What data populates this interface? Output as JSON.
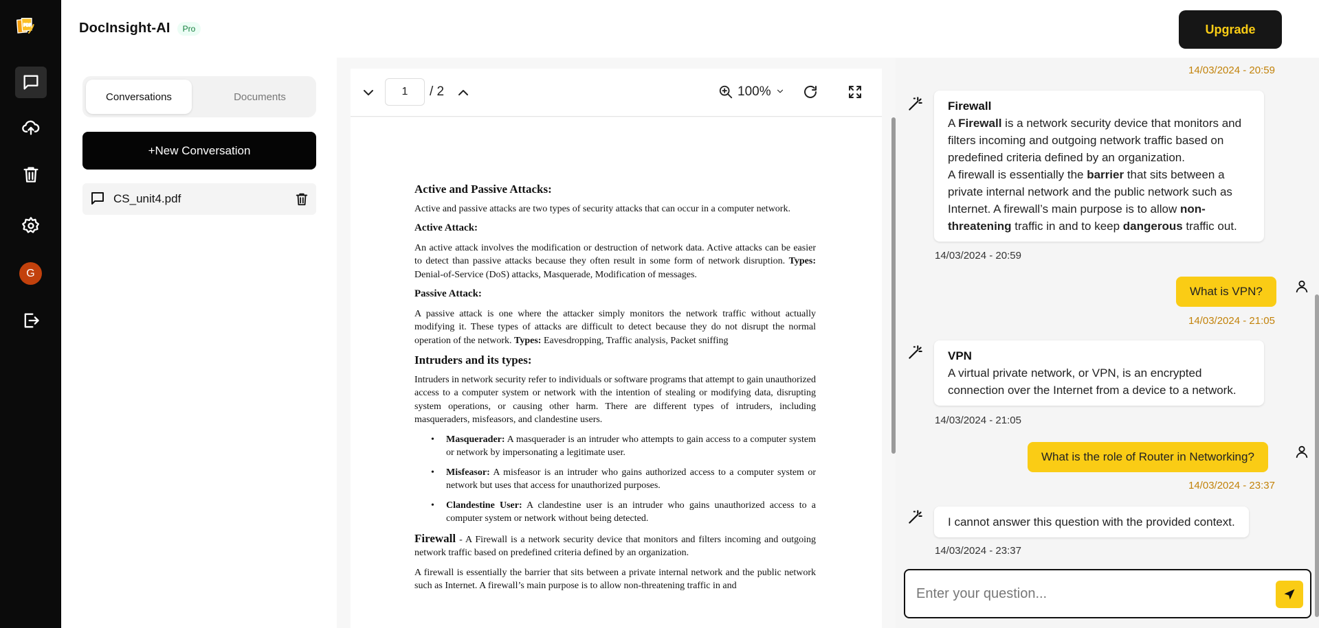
{
  "sidebar": {
    "logo_text": "PDF",
    "avatar_initial": "G"
  },
  "header": {
    "app_name": "DocInsight-AI",
    "badge": "Pro",
    "upgrade_label": "Upgrade"
  },
  "left_panel": {
    "tabs": [
      "Conversations",
      "Documents"
    ],
    "new_conversation_label": "+New Conversation",
    "conversations": [
      {
        "name": "CS_unit4.pdf"
      }
    ]
  },
  "pdf_viewer": {
    "current_page": "1",
    "total_pages": "/ 2",
    "zoom": "100%",
    "content": {
      "h_active_passive": "Active and Passive Attacks:",
      "p_active_passive": "Active and passive attacks are two types of security attacks that can occur in a computer network.",
      "h_active": "Active Attack:",
      "p_active": "An active attack involves the modification or destruction of network data. Active attacks can be easier to detect than passive attacks because they often result in some form of network disruption.",
      "types_label": "Types:",
      "p_active_types": " Denial-of-Service (DoS) attacks, Masquerade, Modification of messages.",
      "h_passive": "Passive Attack:",
      "p_passive": "A passive attack is one where the attacker simply monitors the network traffic without actually modifying it. These types of attacks are difficult to detect because they do not disrupt the normal operation of the network.",
      "p_passive_types": " Eavesdropping, Traffic analysis, Packet sniffing",
      "h_intruders": "Intruders and its types:",
      "p_intruders": "Intruders in network security refer to individuals or software programs that attempt to gain unauthorized access to a computer system or network with the intention of stealing or modifying data, disrupting system operations, or causing other harm. There are different types of intruders, including masqueraders, misfeasors, and clandestine users.",
      "list": [
        {
          "term": "Masquerader:",
          "text": " A masquerader is an intruder who attempts to gain access to a computer system or network by impersonating a legitimate user."
        },
        {
          "term": "Misfeasor:",
          "text": " A misfeasor is an intruder who gains authorized access to a computer system or network but uses that access for unauthorized purposes."
        },
        {
          "term": "Clandestine User:",
          "text": " A clandestine user is an intruder who gains unauthorized access to a computer system or network without being detected."
        }
      ],
      "firewall_term": "Firewall",
      "p_firewall": " - A Firewall is a network security device that monitors and filters incoming and outgoing network traffic based on predefined criteria defined by an organization.",
      "p_firewall2": "A firewall is essentially the barrier that sits between a private internal network and the public network such as Internet. A firewall’s main purpose is to allow non-threatening traffic in and"
    }
  },
  "chat": {
    "messages": [
      {
        "role": "user_ts",
        "timestamp": "14/03/2024 - 20:59"
      },
      {
        "role": "bot",
        "title": "Firewall",
        "p1_a": "A ",
        "p1_b": "Firewall",
        "p1_c": " is a network security device that monitors and filters incoming and outgoing network traffic based on predefined criteria defined by an organization.",
        "p2_a": "A firewall is essentially the ",
        "p2_b": "barrier",
        "p2_c": " that sits between a private internal network and the public network such as Internet. A firewall’s main purpose is to allow ",
        "p2_d": "non-threatening",
        "p2_e": " traffic in and to keep ",
        "p2_f": "dangerous",
        "p2_g": " traffic out.",
        "timestamp": "14/03/2024 - 20:59"
      },
      {
        "role": "user",
        "text": "What is VPN?",
        "timestamp": "14/03/2024 - 21:05"
      },
      {
        "role": "bot",
        "title": "VPN",
        "text": "A virtual private network, or VPN, is an encrypted connection over the Internet from a device to a network.",
        "timestamp": "14/03/2024 - 21:05"
      },
      {
        "role": "user",
        "text": "What is the role of Router in Networking?",
        "timestamp": "14/03/2024 - 23:37"
      },
      {
        "role": "bot",
        "text": "I cannot answer this question with the provided context.",
        "timestamp": "14/03/2024 - 23:37"
      }
    ],
    "input_placeholder": "Enter your question..."
  },
  "colors": {
    "accent_yellow": "#facc15",
    "rail_bg": "#0b0b0b",
    "user_timestamp": "#c2820a"
  },
  "icons": {
    "rail": [
      "chat-icon",
      "upload-cloud-icon",
      "trash-icon",
      "settings-icon",
      "logout-icon"
    ],
    "pdf_toolbar": [
      "chevron-down-icon",
      "chevron-up-icon",
      "zoom-in-icon",
      "rotate-icon",
      "fullscreen-icon"
    ],
    "chat": [
      "magic-wand-icon",
      "user-icon",
      "send-icon"
    ]
  }
}
